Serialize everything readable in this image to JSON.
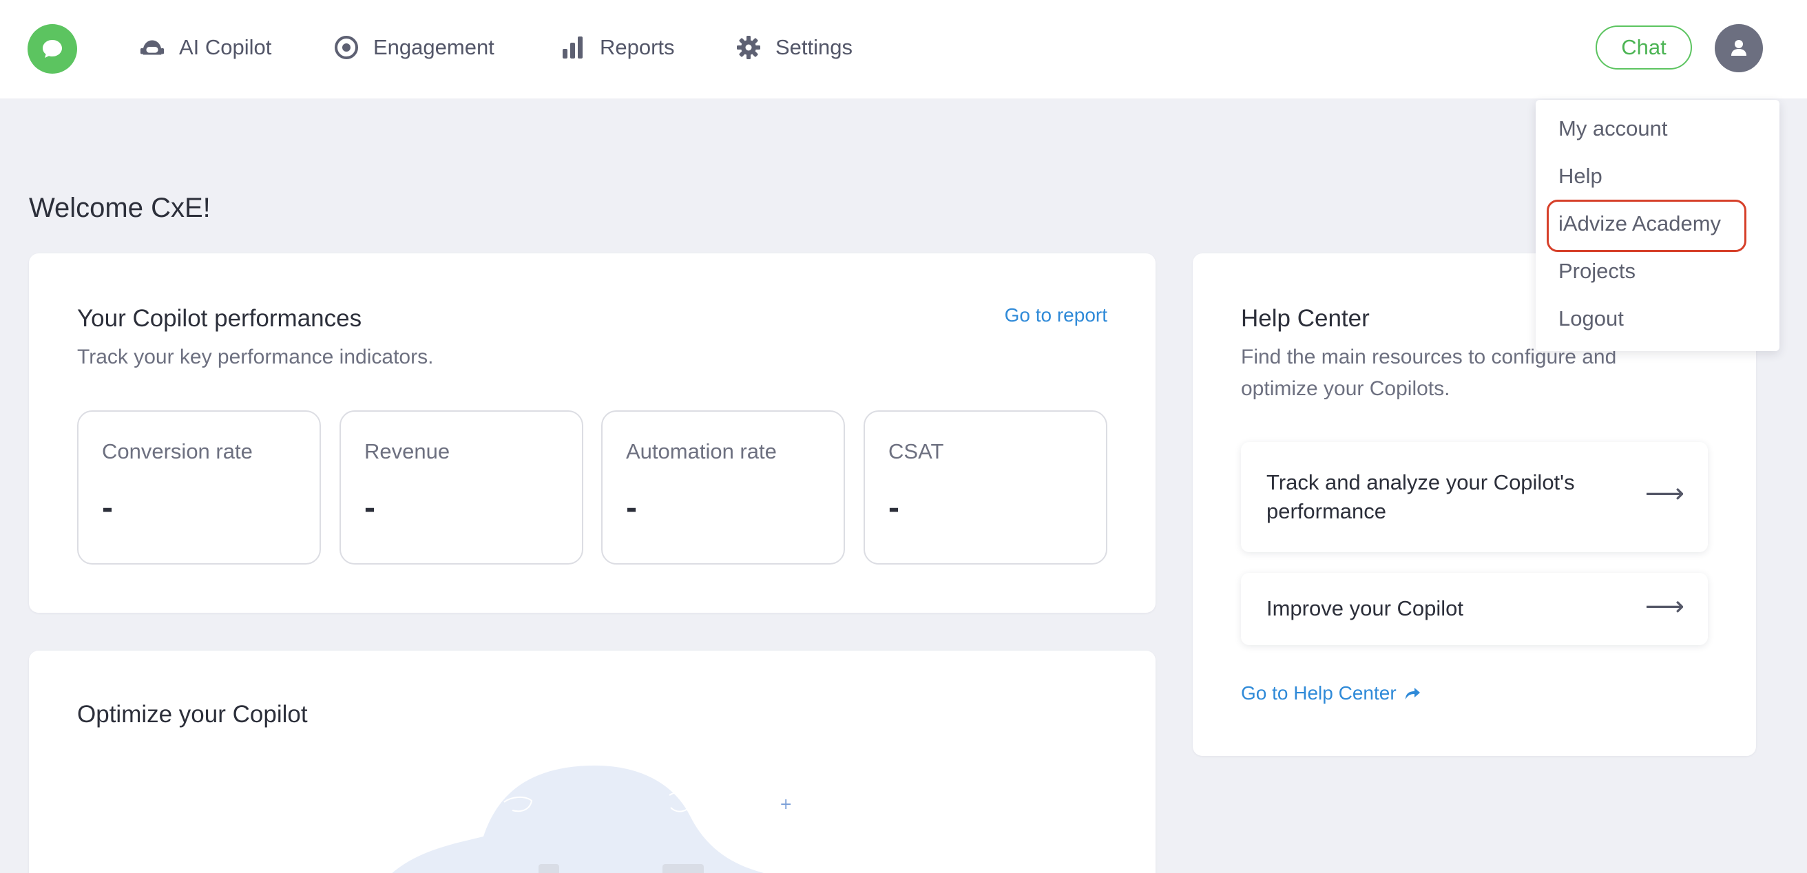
{
  "nav": {
    "items": [
      {
        "label": "AI Copilot",
        "icon": "copilot-icon"
      },
      {
        "label": "Engagement",
        "icon": "target-icon"
      },
      {
        "label": "Reports",
        "icon": "bar-chart-icon"
      },
      {
        "label": "Settings",
        "icon": "gear-icon"
      }
    ],
    "chat_label": "Chat"
  },
  "dropdown": {
    "items": [
      "My account",
      "Help",
      "iAdvize Academy",
      "Projects",
      "Logout"
    ],
    "highlighted": "iAdvize Academy"
  },
  "welcome": "Welcome CxE!",
  "performance": {
    "title": "Your Copilot performances",
    "subtitle": "Track your key performance indicators.",
    "link": "Go to report",
    "kpis": [
      {
        "label": "Conversion rate",
        "value": "-"
      },
      {
        "label": "Revenue",
        "value": "-"
      },
      {
        "label": "Automation rate",
        "value": "-"
      },
      {
        "label": "CSAT",
        "value": "-"
      }
    ]
  },
  "optimize": {
    "title": "Optimize your Copilot"
  },
  "help_center": {
    "title": "Help Center",
    "subtitle": "Find the main resources to configure and optimize your Copilots.",
    "items": [
      {
        "label": "Track and analyze your Copilot's performance"
      },
      {
        "label": "Improve your Copilot"
      }
    ],
    "link": "Go to Help Center"
  },
  "colors": {
    "brand_green": "#5cc460",
    "link_blue": "#2f8ad8",
    "highlight_red": "#d6402a",
    "background": "#eff0f5"
  }
}
